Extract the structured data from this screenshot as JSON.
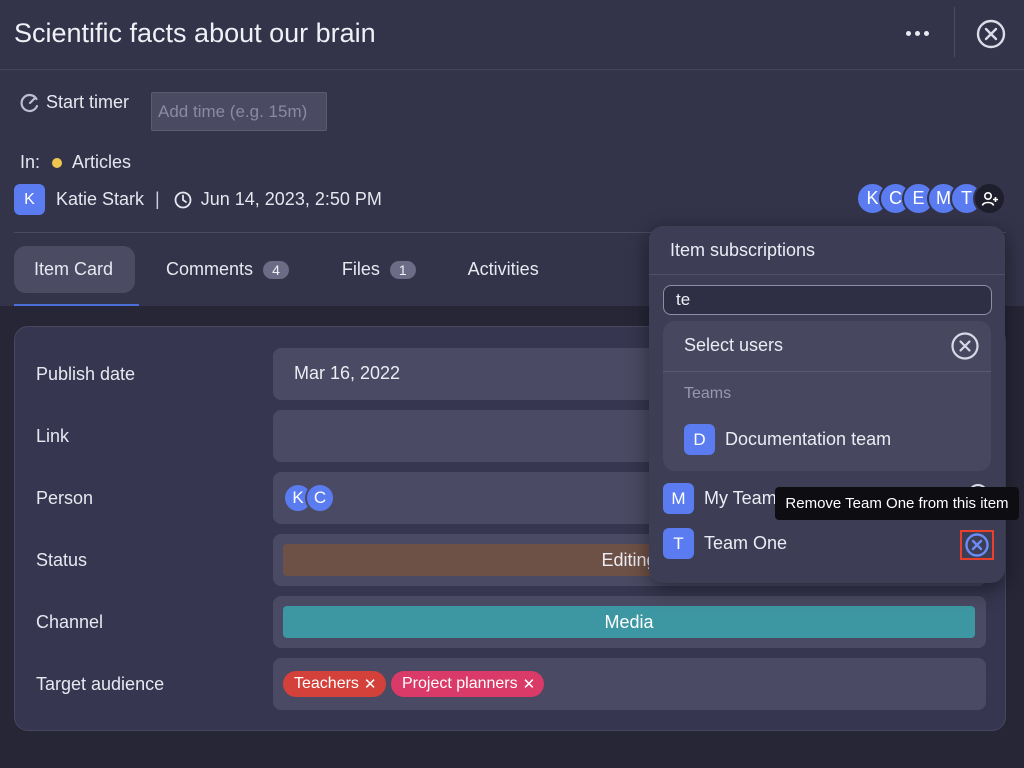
{
  "header": {
    "title": "Scientific facts about our brain",
    "more_label": "More options",
    "close_label": "Close"
  },
  "timer": {
    "start_label": "Start timer",
    "placeholder": "Add time (e.g. 15m)"
  },
  "location": {
    "prefix": "In:",
    "folder": "Articles",
    "folder_color": "#f0c74e"
  },
  "owner": {
    "initial": "K",
    "name": "Katie Stark",
    "separator": "|",
    "date": "Jun 14, 2023, 2:50 PM"
  },
  "subscribers": {
    "initials": [
      "K",
      "C",
      "E",
      "M",
      "T"
    ],
    "add_icon": "add-user-icon"
  },
  "tabs": [
    {
      "label": "Item Card",
      "badge": null
    },
    {
      "label": "Comments",
      "badge": "4"
    },
    {
      "label": "Files",
      "badge": "1"
    },
    {
      "label": "Activities",
      "badge": null
    }
  ],
  "fields": {
    "publish_date": {
      "label": "Publish date",
      "value": "Mar 16, 2022"
    },
    "link": {
      "label": "Link",
      "value": ""
    },
    "person": {
      "label": "Person",
      "initials": [
        "K",
        "C"
      ]
    },
    "status": {
      "label": "Status",
      "value": "Editing",
      "color": "#6e5146"
    },
    "channel": {
      "label": "Channel",
      "value": "Media",
      "color": "#3d97a2"
    },
    "target_audience": {
      "label": "Target audience",
      "tags": [
        {
          "label": "Teachers",
          "color": "#d4413a"
        },
        {
          "label": "Project planners",
          "color": "#d93a67"
        }
      ]
    }
  },
  "subscriptions_popup": {
    "title": "Item subscriptions",
    "search_value": "te",
    "dropdown": {
      "title": "Select users",
      "section": "Teams",
      "items": [
        {
          "initial": "D",
          "label": "Documentation team"
        }
      ]
    },
    "subscribed": [
      {
        "initial": "M",
        "label": "My Team"
      },
      {
        "initial": "T",
        "label": "Team One"
      }
    ]
  },
  "tooltip": {
    "text": "Remove Team One from this item"
  }
}
